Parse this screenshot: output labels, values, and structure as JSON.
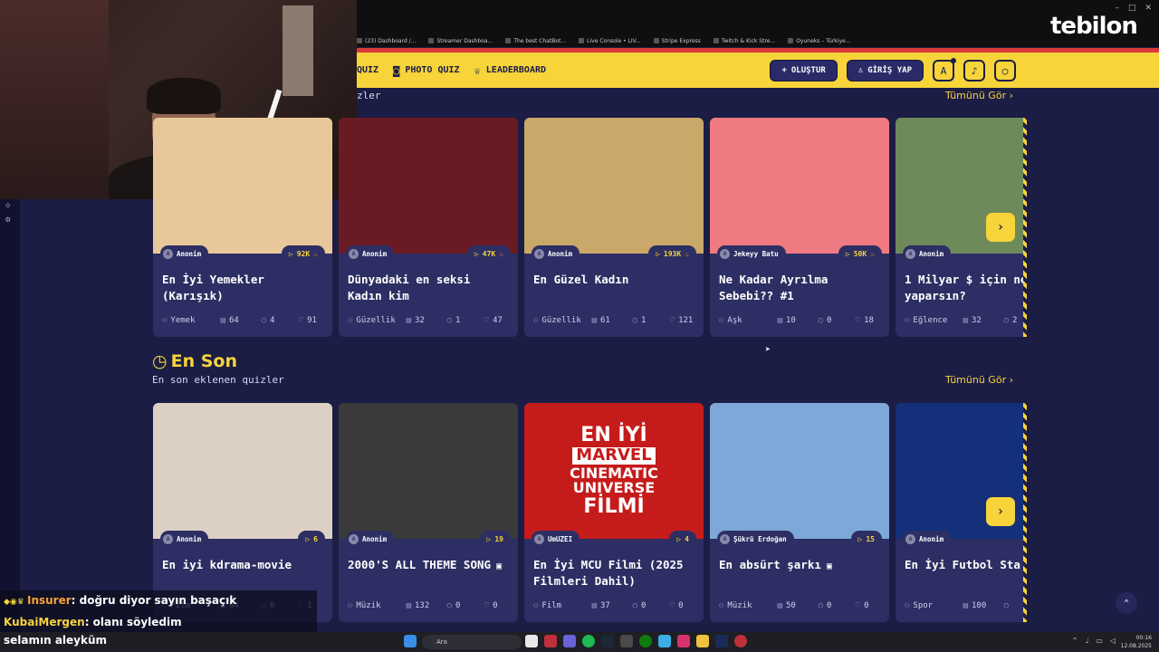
{
  "browser": {
    "bookmarks": [
      "(23) Dashboard /...",
      "Streamer Dashboa...",
      "The best ChatBot...",
      "Live Console • LIV...",
      "Stripe Express",
      "Twitch & Kick Stre...",
      "Oyuneks – Türkiye..."
    ]
  },
  "logo": "tebilon",
  "nav": {
    "links": [
      {
        "label": "QUIZ",
        "icon": "quiz-icon"
      },
      {
        "label": "PHOTO QUIZ",
        "icon": "camera-icon"
      },
      {
        "label": "LEADERBOARD",
        "icon": "trophy-icon"
      }
    ],
    "create_label": "OLUŞTUR",
    "login_label": "GİRİŞ YAP"
  },
  "popular": {
    "subtitle_partial": "zler",
    "see_all": "Tümünü Gör",
    "cards": [
      {
        "author": "Anonim",
        "views": "92K",
        "title": "En İyi Yemekler (Karışık)",
        "category": "Yemek",
        "questions": "64",
        "comments": "4",
        "likes": "91",
        "thumb": "#e8c89a"
      },
      {
        "author": "Anonim",
        "views": "47K",
        "title": "Dünyadaki en seksi Kadın kim",
        "category": "Güzellik",
        "questions": "32",
        "comments": "1",
        "likes": "47",
        "thumb": "#6a1a22"
      },
      {
        "author": "Anonim",
        "views": "193K",
        "title": "En Güzel Kadın",
        "category": "Güzellik",
        "questions": "61",
        "comments": "1",
        "likes": "121",
        "thumb": "#caa86a"
      },
      {
        "author": "Jekeyy Batu",
        "views": "50K",
        "title": "Ne Kadar Ayrılma Sebebi?? #1",
        "category": "Aşk",
        "questions": "10",
        "comments": "0",
        "likes": "18",
        "thumb": "#f07a82"
      },
      {
        "author": "Anonim",
        "views": "",
        "title": "1 Milyar $ için ne yaparsın?",
        "category": "Eğlence",
        "questions": "32",
        "comments": "2",
        "likes": "",
        "thumb": "#6f8a5a"
      }
    ]
  },
  "latest": {
    "title": "En Son",
    "subtitle": "En son eklenen quizler",
    "see_all": "Tümünü Gör",
    "cards": [
      {
        "author": "Anonim",
        "views": "6",
        "title": "En iyi kdrama-movie",
        "category": "Film",
        "questions": "64",
        "comments": "0",
        "likes": "1",
        "thumb": "#dcd0c4"
      },
      {
        "author": "Anonim",
        "views": "19",
        "title": "2000'S ALL THEME SONG",
        "category": "Müzik",
        "questions": "132",
        "comments": "0",
        "likes": "0",
        "thumb": "#3a3a3a",
        "video": true
      },
      {
        "author": "UmUZEI",
        "views": "4",
        "title": "En İyi MCU Filmi (2025 Filmleri Dahil)",
        "category": "Film",
        "questions": "37",
        "comments": "0",
        "likes": "0",
        "thumb": "#c61b1b"
      },
      {
        "author": "Şükrü Erdoğan",
        "views": "15",
        "title": "En absürt şarkı",
        "category": "Müzik",
        "questions": "50",
        "comments": "0",
        "likes": "0",
        "thumb": "#7ea8d8",
        "video": true
      },
      {
        "author": "Anonim",
        "views": "",
        "title": "En İyi Futbol Sta",
        "category": "Spor",
        "questions": "100",
        "comments": "",
        "likes": "",
        "thumb": "#14307a"
      }
    ],
    "mcu_thumb": {
      "line1": "EN İYİ",
      "brand": "MARVEL",
      "line2": "CINEMATIC",
      "line3": "UNIVERSE",
      "line4": "FİLMİ"
    }
  },
  "chat": [
    {
      "user": "Insurer",
      "msg": ": doğru diyor sayın başaçık"
    },
    {
      "user": "KubaiMergen",
      "msg": ": olanı söyledim"
    }
  ],
  "ticker": "selamın aleyküm",
  "taskbar": {
    "search": "Ara",
    "time": "00:16",
    "date": "12.08.2025"
  }
}
